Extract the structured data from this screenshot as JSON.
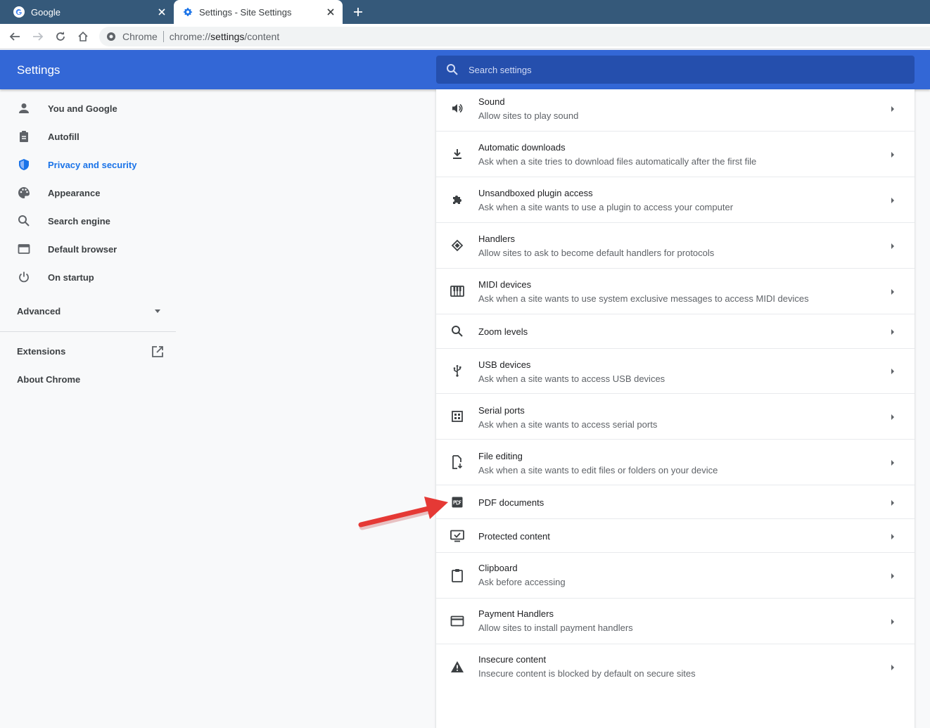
{
  "tabs": [
    {
      "title": "Google",
      "active": false,
      "icon": "google-g-icon"
    },
    {
      "title": "Settings - Site Settings",
      "active": true,
      "icon": "gear-icon"
    }
  ],
  "omnibox": {
    "chip": "Chrome",
    "url_scheme": "chrome://",
    "url_host": "settings",
    "url_path": "/content"
  },
  "header": {
    "title": "Settings",
    "search_placeholder": "Search settings"
  },
  "sidebar": {
    "items": [
      {
        "label": "You and Google",
        "icon": "person-icon",
        "active": false
      },
      {
        "label": "Autofill",
        "icon": "clipboard-icon",
        "active": false
      },
      {
        "label": "Privacy and security",
        "icon": "shield-icon",
        "active": true
      },
      {
        "label": "Appearance",
        "icon": "palette-icon",
        "active": false
      },
      {
        "label": "Search engine",
        "icon": "search-icon",
        "active": false
      },
      {
        "label": "Default browser",
        "icon": "browser-window-icon",
        "active": false
      },
      {
        "label": "On startup",
        "icon": "power-icon",
        "active": false
      }
    ],
    "advanced_label": "Advanced",
    "extensions_label": "Extensions",
    "about_label": "About Chrome"
  },
  "site_settings": [
    {
      "title": "Sound",
      "subtitle": "Allow sites to play sound",
      "icon": "speaker-icon"
    },
    {
      "title": "Automatic downloads",
      "subtitle": "Ask when a site tries to download files automatically after the first file",
      "icon": "download-icon"
    },
    {
      "title": "Unsandboxed plugin access",
      "subtitle": "Ask when a site wants to use a plugin to access your computer",
      "icon": "puzzle-icon"
    },
    {
      "title": "Handlers",
      "subtitle": "Allow sites to ask to become default handlers for protocols",
      "icon": "handler-diamond-icon"
    },
    {
      "title": "MIDI devices",
      "subtitle": "Ask when a site wants to use system exclusive messages to access MIDI devices",
      "icon": "piano-icon"
    },
    {
      "title": "Zoom levels",
      "subtitle": "",
      "icon": "zoom-icon"
    },
    {
      "title": "USB devices",
      "subtitle": "Ask when a site wants to access USB devices",
      "icon": "usb-icon"
    },
    {
      "title": "Serial ports",
      "subtitle": "Ask when a site wants to access serial ports",
      "icon": "serial-port-icon"
    },
    {
      "title": "File editing",
      "subtitle": "Ask when a site wants to edit files or folders on your device",
      "icon": "file-edit-icon"
    },
    {
      "title": "PDF documents",
      "subtitle": "",
      "icon": "pdf-icon"
    },
    {
      "title": "Protected content",
      "subtitle": "",
      "icon": "protected-content-icon"
    },
    {
      "title": "Clipboard",
      "subtitle": "Ask before accessing",
      "icon": "clipboard-icon"
    },
    {
      "title": "Payment Handlers",
      "subtitle": "Allow sites to install payment handlers",
      "icon": "credit-card-icon"
    },
    {
      "title": "Insecure content",
      "subtitle": "Insecure content is blocked by default on secure sites",
      "icon": "warning-icon"
    }
  ],
  "colors": {
    "tabstrip": "#35597a",
    "header": "#3367d6",
    "search_box": "#254fad",
    "active_nav": "#1a73e8",
    "annotation_arrow": "#e53935"
  }
}
